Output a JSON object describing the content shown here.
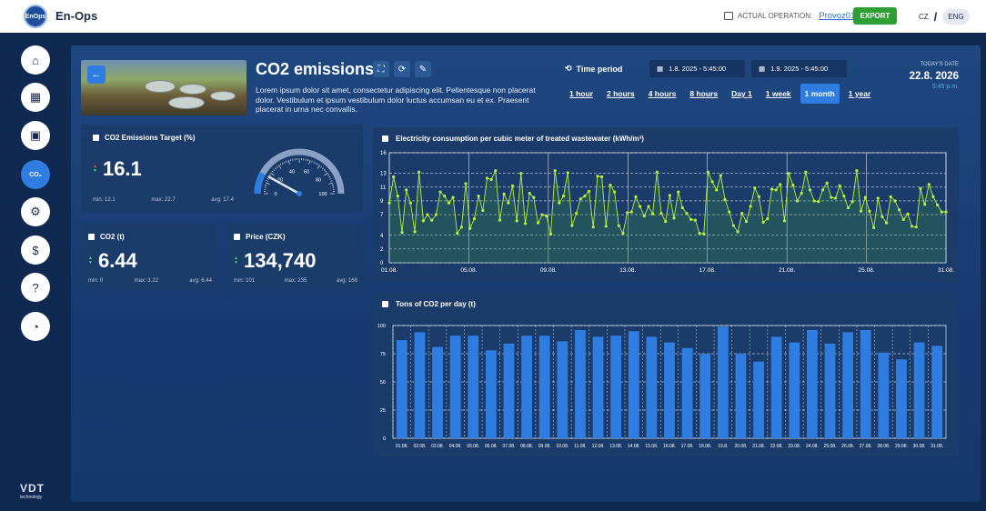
{
  "app": {
    "title": "En-Ops",
    "logo_text": "EnOps",
    "actual_operation_label": "ACTUAL OPERATION:",
    "actual_operation_value": "Provoz01",
    "export_label": "EXPORT",
    "lang_cz": "CZ",
    "lang_separator": "/",
    "lang_eng": "ENG"
  },
  "nav": {
    "items": [
      {
        "icon": "home-icon",
        "glyph": "⌂"
      },
      {
        "icon": "calendar-icon",
        "glyph": "▦"
      },
      {
        "icon": "calendar-event-icon",
        "glyph": "▣"
      },
      {
        "icon": "co2-icon",
        "glyph": "CO₂",
        "active": true
      },
      {
        "icon": "robot-arm-icon",
        "glyph": "⚙"
      },
      {
        "icon": "dollar-icon",
        "glyph": "$"
      },
      {
        "icon": "help-icon",
        "glyph": "?"
      },
      {
        "icon": "gauge-icon",
        "glyph": "◔"
      }
    ],
    "brand": "VDT",
    "brand_sub": "technology"
  },
  "header": {
    "title": "CO2 emissions",
    "description": "Lorem ipsum dolor sit amet, consectetur adipiscing elit. Pellentesque non placerat dolor. Vestibulum et ipsum vestibulum dolor luctus accumsan eu et ex. Praesent placerat in urna nec convallis.",
    "time_period_label": "Time period",
    "date_from": "1.8. 2025 - 5:45:00",
    "date_to": "1.9. 2025 - 5:45:00",
    "periods": [
      "1 hour",
      "2 hours",
      "4 hours",
      "8 hours",
      "Day 1",
      "1 week",
      "1 month",
      "1 year"
    ],
    "active_period": "1 month",
    "today_label": "TODAY'S DATE",
    "today_date": "22.8. 2026",
    "today_time": "5:45 p.m."
  },
  "kpis": {
    "target": {
      "title": "CO2 Emissions Target (%)",
      "value": "16.1",
      "min": "min: 12.1",
      "max": "max: 22.7",
      "avg": "avg: 17.4",
      "gauge_value": 16.1,
      "gauge_max": 100,
      "gauge_ticks": [
        "0",
        "20",
        "40",
        "60",
        "80",
        "100"
      ]
    },
    "co2": {
      "title": "CO2 (t)",
      "value": "6.44",
      "min": "min: 0",
      "max": "max: 3.22",
      "avg": "avg: 6.44"
    },
    "price": {
      "title": "Price (CZK)",
      "value": "134,740",
      "min": "min: 101",
      "max": "max: 235",
      "avg": "avg: 168"
    }
  },
  "colors": {
    "line": "#b7ef3a",
    "bar": "#2f7de1",
    "accent": "#2f7de1",
    "export": "#2e9e35"
  },
  "chart_data": [
    {
      "type": "line",
      "title": "Electricity consumption per cubic meter of treated wastewater (kWh/m³)",
      "ylim": [
        0,
        16
      ],
      "yticks": [
        0,
        2,
        4,
        7,
        9,
        11,
        13,
        16
      ],
      "xticks": [
        "01.08.",
        "05.08.",
        "09.08.",
        "13.08.",
        "17.08.",
        "21.08.",
        "25.08.",
        "31.08."
      ],
      "grid": true,
      "values": [
        8.7,
        12.5,
        9.7,
        4.4,
        10.6,
        8.7,
        4.5,
        13.2,
        6.1,
        7.0,
        6.2,
        7.0,
        10.3,
        9.7,
        8.7,
        9.5,
        4.3,
        5.2,
        11.5,
        5.0,
        6.4,
        9.7,
        7.6,
        12.3,
        12.1,
        13.4,
        6.2,
        10.0,
        8.7,
        11.2,
        6.1,
        13.0,
        5.7,
        10.1,
        9.5,
        5.8,
        7.0,
        6.8,
        4.2,
        13.4,
        8.7,
        9.7,
        13.1,
        5.4,
        7.2,
        9.3,
        9.7,
        10.4,
        5.2,
        12.6,
        12.5,
        5.3,
        11.3,
        10.3,
        5.4,
        4.3,
        7.3,
        7.4,
        9.6,
        8.2,
        6.8,
        8.2,
        7.1,
        13.2,
        7.2,
        6.0,
        9.8,
        6.5,
        10.3,
        8.0,
        7.2,
        6.3,
        6.2,
        4.3,
        4.2,
        13.2,
        11.8,
        10.6,
        12.7,
        9.2,
        7.4,
        5.4,
        4.5,
        7.2,
        6.0,
        8.2,
        10.9,
        9.6,
        5.9,
        6.4,
        10.7,
        10.6,
        11.4,
        6.1,
        13.0,
        11.3,
        9.0,
        10.1,
        13.2,
        10.6,
        9.0,
        8.9,
        10.6,
        11.6,
        9.5,
        9.4,
        11.2,
        9.7,
        8.0,
        8.9,
        13.4,
        7.5,
        9.5,
        7.5,
        5.1,
        9.4,
        6.7,
        5.8,
        9.6,
        9.0,
        7.7,
        6.3,
        7.1,
        5.3,
        5.2,
        10.8,
        8.5,
        11.4,
        9.6,
        8.4,
        7.4,
        7.4
      ]
    },
    {
      "type": "bar",
      "title": "Tons of CO2 per day (t)",
      "ylim": [
        0,
        100
      ],
      "yticks": [
        0,
        25,
        50,
        75,
        100
      ],
      "grid": true,
      "categories": [
        "01.08.",
        "02.08.",
        "03.08.",
        "04.08.",
        "05.08.",
        "06.08.",
        "07.08.",
        "08.08.",
        "09.08.",
        "10.08.",
        "11.08.",
        "12.08.",
        "13.08.",
        "14.08.",
        "15.08.",
        "16.08.",
        "17.08.",
        "18.08.",
        "19.8.",
        "20.08.",
        "21.08.",
        "22.08.",
        "23.08.",
        "24.08.",
        "25.08.",
        "26.08.",
        "27.08.",
        "28.08.",
        "29.08.",
        "30.08.",
        "31.08."
      ],
      "values": [
        87,
        94,
        81,
        91,
        91,
        78,
        84,
        91,
        91,
        86,
        96,
        90,
        91,
        95,
        90,
        85,
        80,
        75,
        99,
        75,
        68,
        90,
        85,
        96,
        84,
        94,
        96,
        76,
        70,
        85,
        82
      ]
    }
  ]
}
